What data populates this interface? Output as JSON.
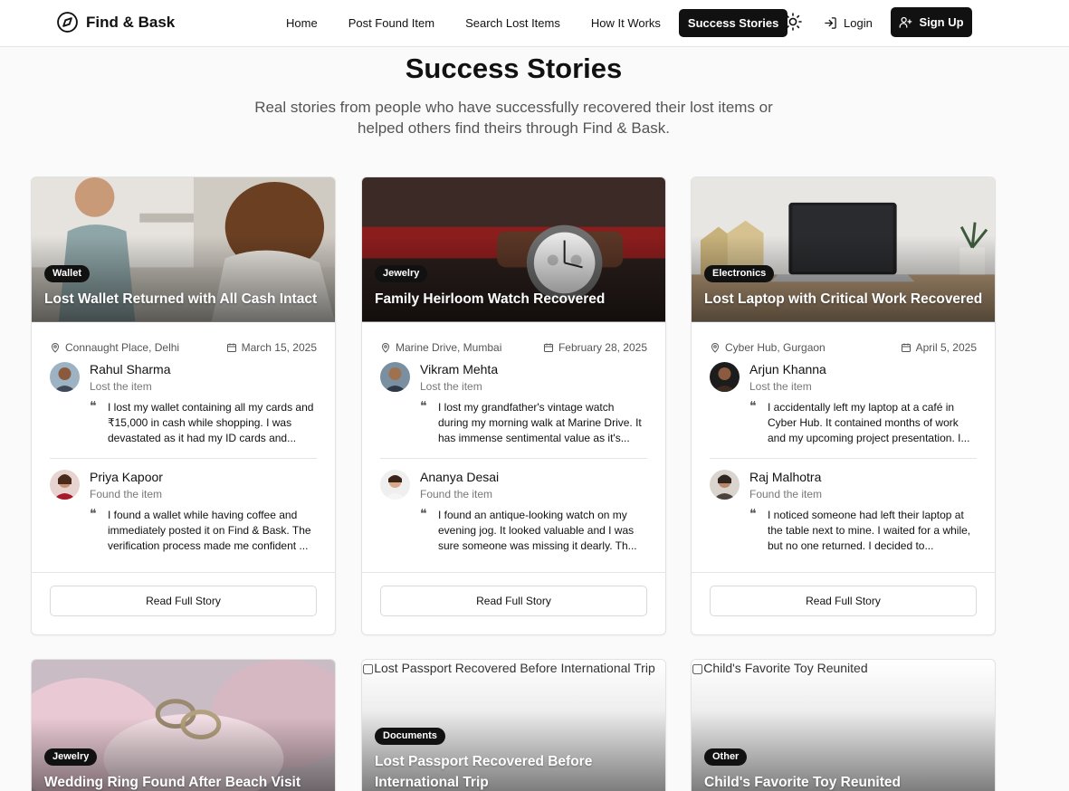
{
  "brand": {
    "name": "Find & Bask"
  },
  "nav": {
    "items": [
      "Home",
      "Post Found Item",
      "Search Lost Items",
      "How It Works",
      "Success Stories"
    ],
    "active": "Success Stories",
    "login": "Login",
    "signup": "Sign Up"
  },
  "hero": {
    "title": "Success Stories",
    "subtitle": "Real stories from people who have successfully recovered their lost items or helped others find theirs through Find & Bask."
  },
  "cards": [
    {
      "category": "Wallet",
      "title": "Lost Wallet Returned with All Cash Intact",
      "location": "Connaught Place, Delhi",
      "date": "March 15, 2025",
      "loser": {
        "name": "Rahul Sharma",
        "role": "Lost the item",
        "quote": "I lost my wallet containing all my cards and ₹15,000 in cash while shopping. I was devastated as it had my ID cards and..."
      },
      "finder": {
        "name": "Priya Kapoor",
        "role": "Found the item",
        "quote": "I found a wallet while having coffee and immediately posted it on Find & Bask. The verification process made me confident ..."
      },
      "button": "Read Full Story"
    },
    {
      "category": "Jewelry",
      "title": "Family Heirloom Watch Recovered",
      "location": "Marine Drive, Mumbai",
      "date": "February 28, 2025",
      "loser": {
        "name": "Vikram Mehta",
        "role": "Lost the item",
        "quote": "I lost my grandfather's vintage watch during my morning walk at Marine Drive. It has immense sentimental value as it's..."
      },
      "finder": {
        "name": "Ananya Desai",
        "role": "Found the item",
        "quote": "I found an antique-looking watch on my evening jog. It looked valuable and I was sure someone was missing it dearly. Th..."
      },
      "button": "Read Full Story"
    },
    {
      "category": "Electronics",
      "title": "Lost Laptop with Critical Work Recovered",
      "location": "Cyber Hub, Gurgaon",
      "date": "April 5, 2025",
      "loser": {
        "name": "Arjun Khanna",
        "role": "Lost the item",
        "quote": "I accidentally left my laptop at a café in Cyber Hub. It contained months of work and my upcoming project presentation. I..."
      },
      "finder": {
        "name": "Raj Malhotra",
        "role": "Found the item",
        "quote": "I noticed someone had left their laptop at the table next to mine. I waited for a while, but no one returned. I decided to..."
      },
      "button": "Read Full Story"
    },
    {
      "category": "Jewelry",
      "title": "Wedding Ring Found After Beach Visit"
    },
    {
      "category": "Documents",
      "title": "Lost Passport Recovered Before International Trip",
      "alt": "Lost Passport Recovered Before International Trip"
    },
    {
      "category": "Other",
      "title": "Child's Favorite Toy Reunited",
      "alt": "Child's Favorite Toy Reunited"
    }
  ],
  "colors": {
    "primary": "#111111",
    "background": "#fafafa",
    "muted": "#777777"
  }
}
